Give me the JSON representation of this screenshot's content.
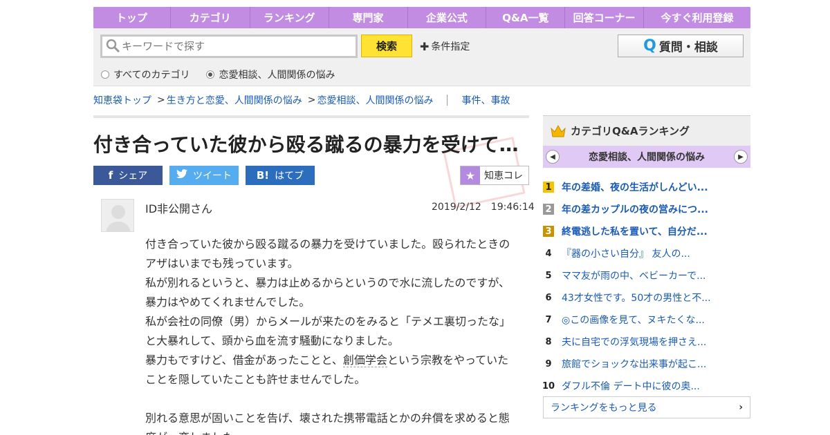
{
  "nav": {
    "items": [
      "トップ",
      "カテゴリ",
      "ランキング",
      "専門家",
      "企業公式",
      "Q&A一覧",
      "回答コーナー",
      "今すぐ利用登録"
    ]
  },
  "search": {
    "placeholder": "キーワードで探す",
    "button": "検索",
    "conditions": "条件指定",
    "ask_button": "質問・相談",
    "radio_all": "すべてのカテゴリ",
    "radio_category": "恋愛相談、人間関係の悩み"
  },
  "breadcrumb": {
    "items": [
      "知恵袋トップ",
      "生き方と恋愛、人間関係の悩み",
      "恋愛相談、人間関係の悩み"
    ],
    "related": "事件、事故"
  },
  "question": {
    "title": "付き合っていた彼から殴る蹴るの暴力を受けて…",
    "share_fb": "シェア",
    "share_tw": "ツイート",
    "share_hb": "はてブ",
    "collect": "知恵コレ",
    "user": "ID非公開さん",
    "date": "2019/2/12　19:46:14",
    "lines": [
      "付き合っていた彼から殴る蹴るの暴力を受けていました。殴られたときの",
      "アザはいまでも残っています。",
      "私が別れるというと、暴力は止めるからというので水に流したのですが、",
      "暴力はやめてくれませんでした。",
      "私が会社の同僚（男）からメールが来たのをみると「テメエ裏切ったな」",
      "と大暴れして、頭から血を流す騒動になりました。"
    ],
    "line7_pre": "暴力もですけど、借金があったことと、",
    "line7_link": "創価学会",
    "line7_post": "という宗教をやっていた",
    "line8": "ことを隠していたことも許せませんでした。",
    "line9": "別れる意思が固いことを告げ、壊された携帯電話とかの弁償を求めると態",
    "line10": "度が一変しました。"
  },
  "sidebar": {
    "title": "カテゴリQ&Aランキング",
    "category": "恋愛相談、人間関係の悩み",
    "ranking": [
      {
        "num": "1",
        "text": "年の差婚、夜の生活がしんどい..."
      },
      {
        "num": "2",
        "text": "年の差カップルの夜の営みにつ..."
      },
      {
        "num": "3",
        "text": "終電逃した私を置いて、自分だ..."
      },
      {
        "num": "4",
        "text": "『器の小さい自分』 友人の..."
      },
      {
        "num": "5",
        "text": "ママ友が雨の中、ベビーカーで..."
      },
      {
        "num": "6",
        "text": "43才女性です。50才の男性と不..."
      },
      {
        "num": "7",
        "text": "◎この画像を見て、ヌキたくな..."
      },
      {
        "num": "8",
        "text": "夫に自宅での浮気現場を押さえ..."
      },
      {
        "num": "9",
        "text": "旅館でショックな出来事が起こ..."
      },
      {
        "num": "10",
        "text": "ダフル不倫 デート中に彼の奥..."
      }
    ],
    "more": "ランキングをもっと見る"
  },
  "colors": {
    "nav_bg": "#c18ce2",
    "search_button": "#ffe233",
    "link": "#1a5bb5",
    "facebook": "#3b5998",
    "twitter": "#55acee",
    "hatena": "#2c6ebd"
  }
}
